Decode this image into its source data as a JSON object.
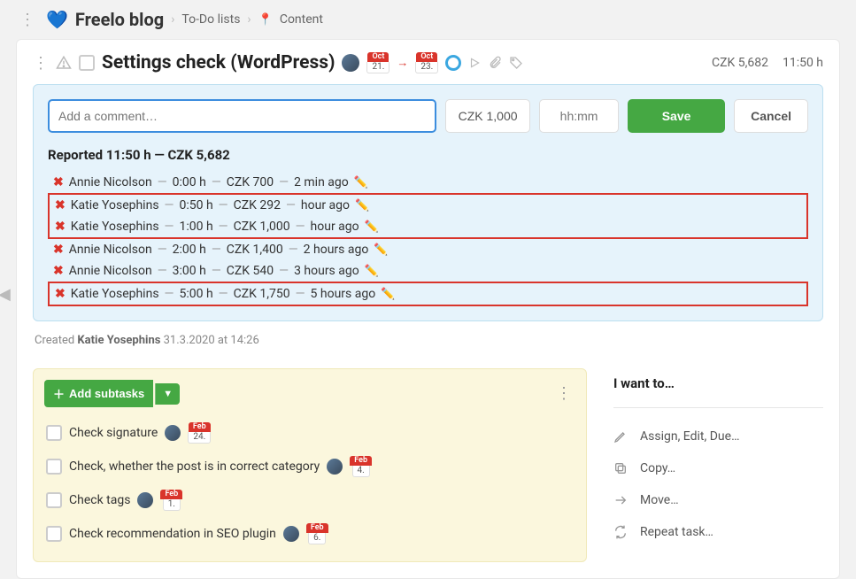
{
  "breadcrumb": {
    "heart": "💙",
    "title": "Freelo blog",
    "item1": "To-Do lists",
    "pin": "📍",
    "item2": "Content"
  },
  "task": {
    "title": "Settings check (WordPress)",
    "date_from_month": "Oct",
    "date_from_day": "21.",
    "date_to_month": "Oct",
    "date_to_day": "23.",
    "cost": "CZK 5,682",
    "hours": "11:50 h"
  },
  "panel": {
    "comment_placeholder": "Add a comment…",
    "amount_value": "CZK 1,000",
    "time_placeholder": "hh:mm",
    "save": "Save",
    "cancel": "Cancel",
    "summary": "Reported 11:50 h — CZK 5,682",
    "entries": [
      {
        "user": "Annie Nicolson",
        "dur": "0:00 h",
        "amt": "CZK 700",
        "ago": "2 min ago",
        "boxed": false
      },
      {
        "user": "Katie Yosephins",
        "dur": "0:50 h",
        "amt": "CZK 292",
        "ago": "hour ago",
        "boxed": true,
        "group_start": true
      },
      {
        "user": "Katie Yosephins",
        "dur": "1:00 h",
        "amt": "CZK 1,000",
        "ago": "hour ago",
        "boxed": true,
        "group_end": true
      },
      {
        "user": "Annie Nicolson",
        "dur": "2:00 h",
        "amt": "CZK 1,400",
        "ago": "2 hours ago",
        "boxed": false
      },
      {
        "user": "Annie Nicolson",
        "dur": "3:00 h",
        "amt": "CZK 540",
        "ago": "3 hours ago",
        "boxed": false
      },
      {
        "user": "Katie Yosephins",
        "dur": "5:00 h",
        "amt": "CZK 1,750",
        "ago": "5 hours ago",
        "boxed": true,
        "solo_box": true
      }
    ]
  },
  "created": {
    "prefix": "Created ",
    "author": "Katie Yosephins",
    "when": " 31.3.2020 at 14:26"
  },
  "subtasks": {
    "add_label": "Add subtasks",
    "items": [
      {
        "label": "Check signature",
        "month": "Feb",
        "day": "24."
      },
      {
        "label": "Check, whether the post is in correct category",
        "month": "Feb",
        "day": "4."
      },
      {
        "label": "Check tags",
        "month": "Feb",
        "day": "1."
      },
      {
        "label": "Check recommendation in SEO plugin",
        "month": "Feb",
        "day": "6."
      }
    ]
  },
  "side": {
    "title": "I want to…",
    "assign": "Assign, Edit, Due…",
    "copy": "Copy…",
    "move": "Move…",
    "repeat": "Repeat task…"
  }
}
